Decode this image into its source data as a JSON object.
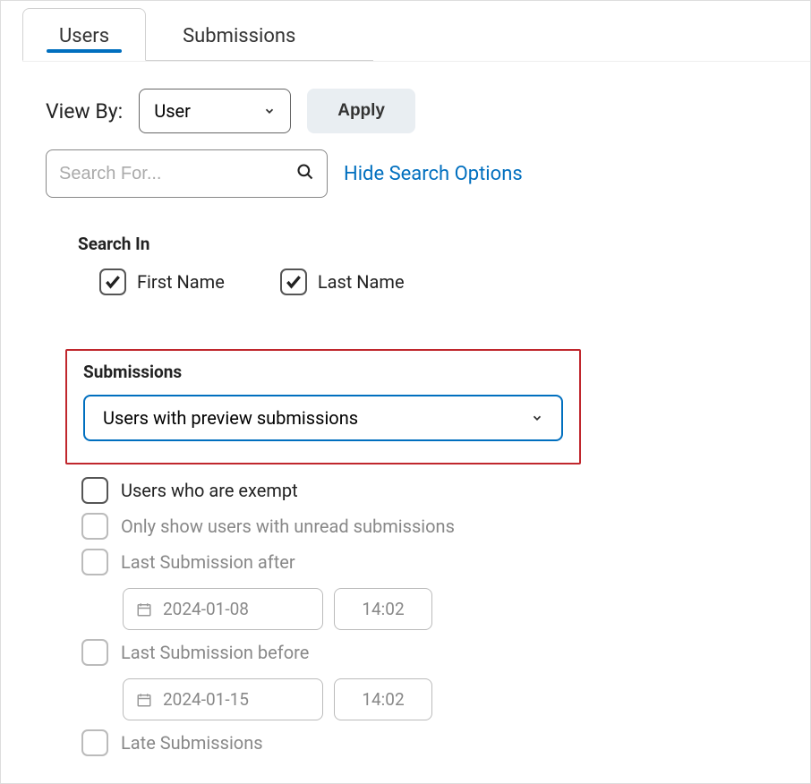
{
  "tabs": {
    "users": "Users",
    "submissions": "Submissions"
  },
  "viewBy": {
    "label": "View By:",
    "selected": "User",
    "applyLabel": "Apply"
  },
  "search": {
    "placeholder": "Search For...",
    "hideLink": "Hide Search Options"
  },
  "searchIn": {
    "label": "Search In",
    "firstName": "First Name",
    "lastName": "Last Name"
  },
  "submissions": {
    "label": "Submissions",
    "selected": "Users with preview submissions"
  },
  "filters": {
    "exempt": "Users who are exempt",
    "unread": "Only show users with unread submissions",
    "after": "Last Submission after",
    "afterDate": "2024-01-08",
    "afterTime": "14:02",
    "before": "Last Submission before",
    "beforeDate": "2024-01-15",
    "beforeTime": "14:02",
    "late": "Late Submissions"
  }
}
